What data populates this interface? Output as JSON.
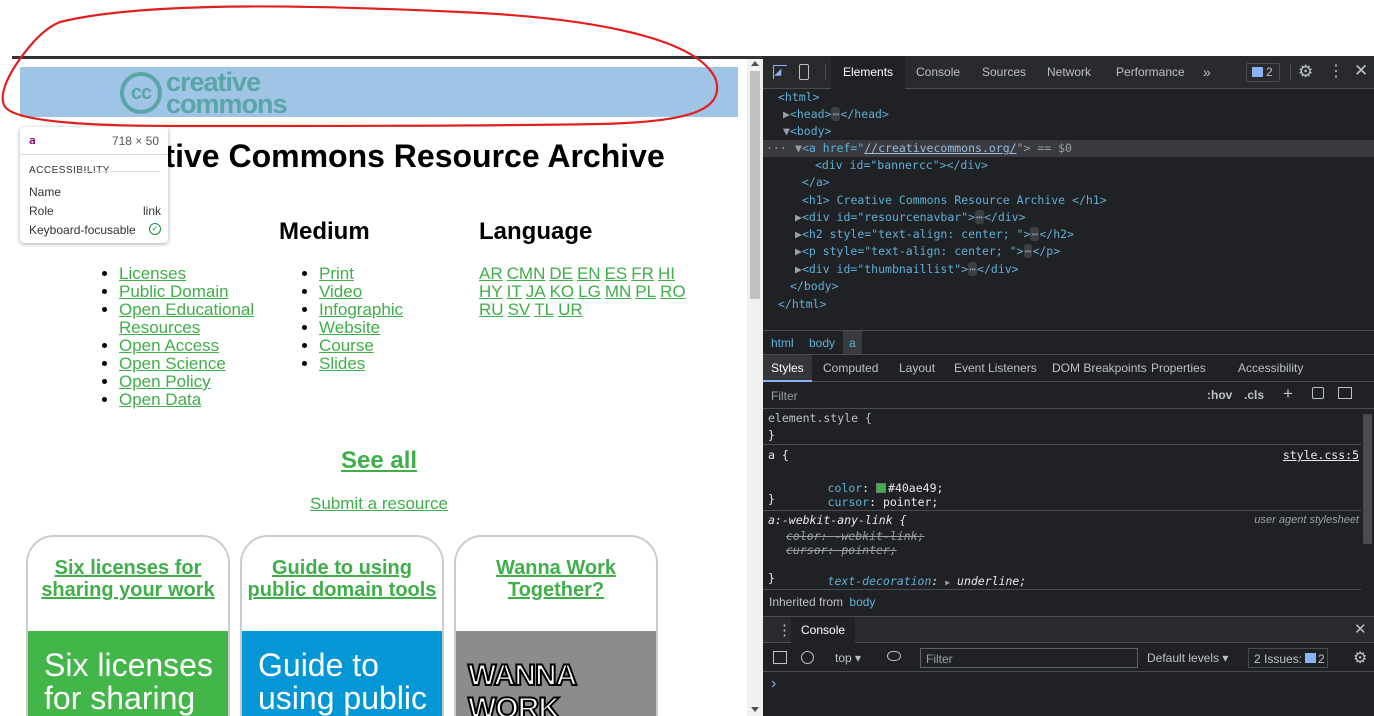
{
  "page": {
    "logo_symbol": "cc",
    "logo_line1": "creative",
    "logo_line2": "commons",
    "title": "Creative Commons Resource Archive",
    "columns": {
      "medium_heading": "Medium",
      "language_heading": "Language"
    },
    "type_links": [
      "Licenses",
      "Public Domain",
      "Open Educational",
      "Resources",
      "Open Access",
      "Open Science",
      "Open Policy",
      "Open Data"
    ],
    "medium_links": [
      "Print",
      "Video",
      "Infographic",
      "Website",
      "Course",
      "Slides"
    ],
    "language_rows": [
      [
        "AR",
        "CMN",
        "DE",
        "EN",
        "ES",
        "FR",
        "HI"
      ],
      [
        "HY",
        "IT",
        "JA",
        "KO",
        "LG",
        "MN",
        "PL",
        "RO"
      ],
      [
        "RU",
        "SV",
        "TL",
        "UR"
      ]
    ],
    "see_all": "See all",
    "submit": "Submit a resource",
    "cards": [
      {
        "title": "Six licenses for sharing your work",
        "image_text": "Six licenses for sharing",
        "color": "#43b649"
      },
      {
        "title": "Guide to using public domain tools",
        "image_text": "Guide to using public",
        "color": "#0496d5"
      },
      {
        "title": "Wanna Work Together?",
        "image_text": "WANNA WORK",
        "color": "#8c8c8c"
      }
    ],
    "link_color": "#40ae49"
  },
  "tooltip": {
    "tag": "a",
    "size": "718 × 50",
    "section": "ACCESSIBILITY",
    "rows": [
      {
        "label": "Name",
        "value": ""
      },
      {
        "label": "Role",
        "value": "link"
      },
      {
        "label": "Keyboard-focusable",
        "value": ""
      }
    ]
  },
  "devtools": {
    "tabs": [
      "Elements",
      "Console",
      "Sources",
      "Network",
      "Performance"
    ],
    "more": "»",
    "issues_badge": "2",
    "dom": {
      "html_open": "<html>",
      "head": "<head>",
      "head_close": "</head>",
      "body_open": "<body>",
      "a_tag": "<a href=\"",
      "a_href": "//creativecommons.org/",
      "a_suffix": "\"> == $0",
      "div_banner": "<div id=\"bannercc\"></div>",
      "a_close": "</a>",
      "h1_line": "<h1> Creative Commons Resource Archive </h1>",
      "div_nav": "<div id=\"resourcenavbar\">",
      "div_close": "</div>",
      "h2_line": "<h2 style=\"text-align: center; \">",
      "h2_close": "</h2>",
      "p_line": "<p style=\"text-align: center; \">",
      "p_close": "</p>",
      "div_thumb": "<div id=\"thumbnaillist\">",
      "body_close": "</body>",
      "html_close": "</html>",
      "ellipsis": "⋯"
    },
    "breadcrumb": [
      "html",
      "body",
      "a"
    ],
    "subtabs": [
      "Styles",
      "Computed",
      "Layout",
      "Event Listeners",
      "DOM Breakpoints",
      "Properties",
      "Accessibility"
    ],
    "filter_placeholder": "Filter",
    "hov": ":hov",
    "cls": ".cls",
    "styles": {
      "element_style": "element.style {",
      "close_brace": "}",
      "a_selector": "a {",
      "a_source": "style.css:5",
      "color_prop": "color",
      "color_value": "#40ae49;",
      "cursor_prop": "cursor",
      "cursor_value": "pointer;",
      "ua_selector": "a:-webkit-any-link {",
      "ua_source": "user agent stylesheet",
      "ua_color": "color: -webkit-link;",
      "ua_cursor": "cursor: pointer;",
      "ua_td_prop": "text-decoration",
      "ua_td_value": "underline;",
      "inherited_label": "Inherited from",
      "inherited_from": "body"
    },
    "console": {
      "title": "Console",
      "context": "top",
      "filter_placeholder": "Filter",
      "levels": "Default levels",
      "issues_label": "2 Issues:",
      "issues_count": "2",
      "prompt": "›"
    }
  }
}
